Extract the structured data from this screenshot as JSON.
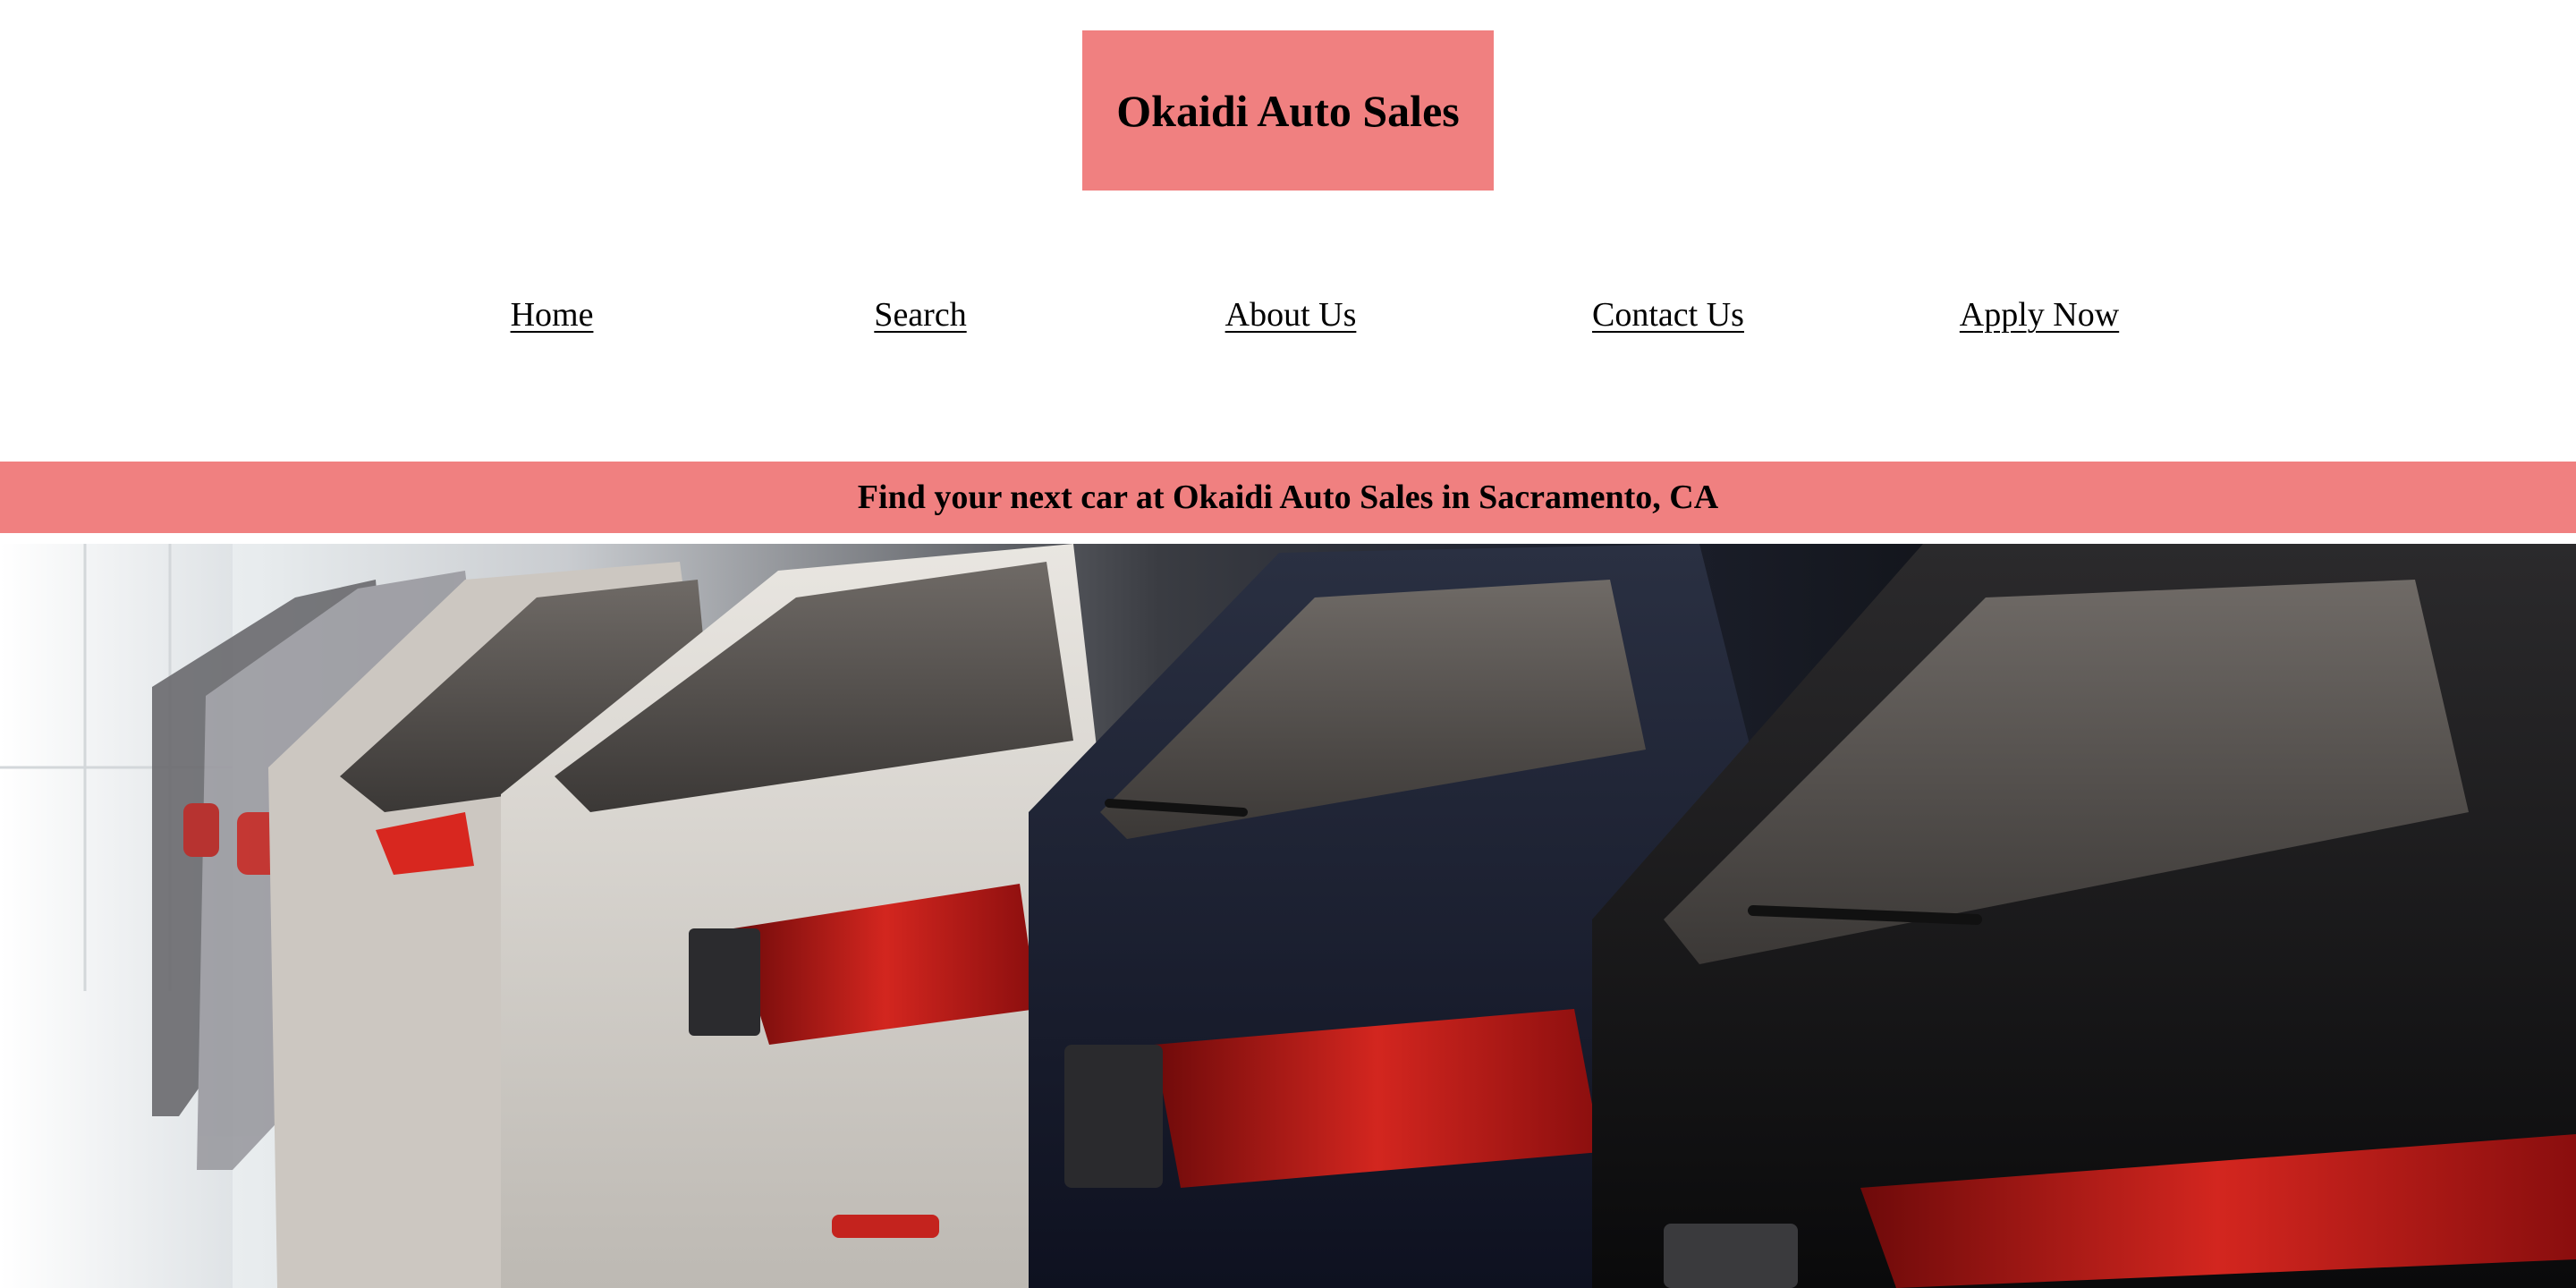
{
  "header": {
    "logo_text": "Okaidi Auto Sales",
    "accent_color": "#f08080"
  },
  "nav": {
    "items": [
      {
        "label": "Home"
      },
      {
        "label": "Search"
      },
      {
        "label": "About Us"
      },
      {
        "label": "Contact Us"
      },
      {
        "label": "Apply Now"
      }
    ]
  },
  "banner": {
    "text": "Find your next car at Okaidi Auto Sales in Sacramento, CA"
  },
  "hero": {
    "image_description": "row of parked SUVs, rear view with red tail lights"
  }
}
